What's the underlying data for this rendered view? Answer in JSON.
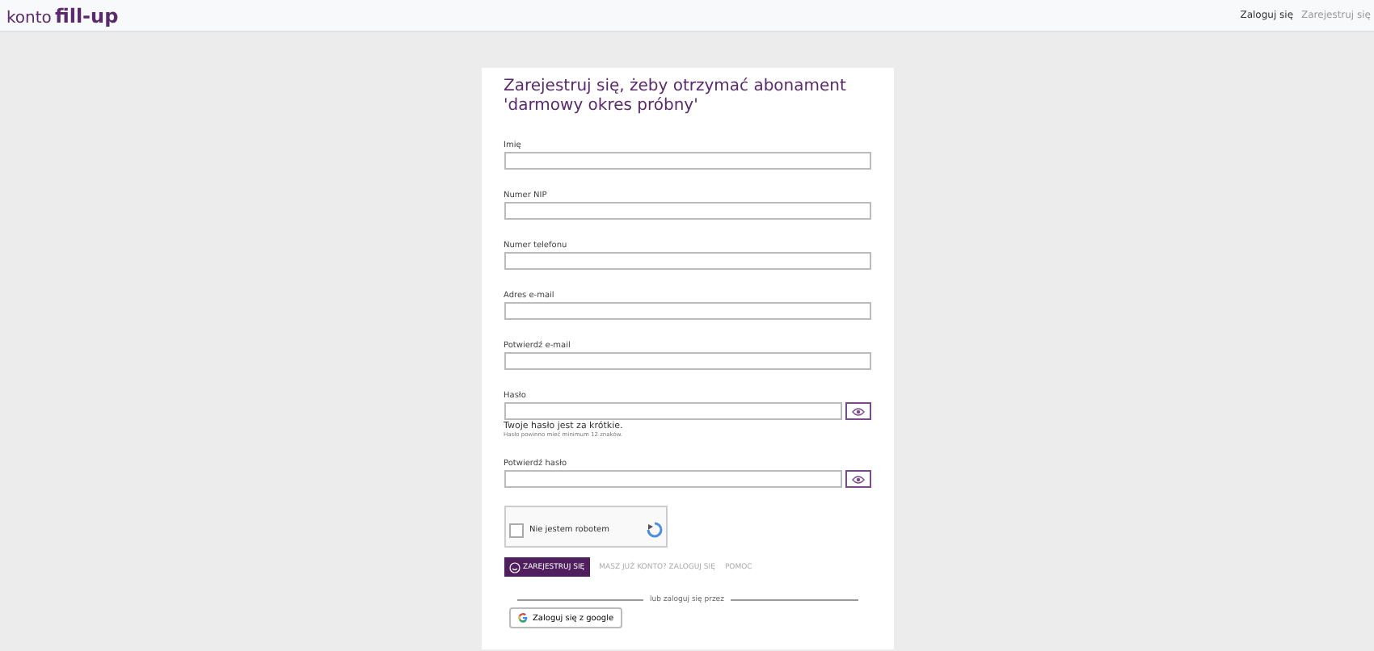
{
  "header": {
    "logo_prefix": "konto",
    "logo_brand": "fill-up",
    "nav": [
      {
        "label": "Zaloguj się",
        "selected": true
      },
      {
        "label": "Zarejestruj się",
        "selected": false
      }
    ]
  },
  "form": {
    "title": "Zarejestruj się, żeby otrzymać abonament 'darmowy okres próbny'",
    "fields": [
      {
        "label": "Imię",
        "kind": "text"
      },
      {
        "label": "Numer NIP",
        "kind": "text"
      },
      {
        "label": "Numer telefonu",
        "kind": "text"
      },
      {
        "label": "Adres e-mail",
        "kind": "text"
      },
      {
        "label": "Potwierdź e-mail",
        "kind": "text"
      },
      {
        "label": "Hasło",
        "kind": "password",
        "error": "Twoje hasło jest za krótkie.",
        "hint": "Hasło powinno mieć minimum 12 znaków."
      },
      {
        "label": "Potwierdź hasło",
        "kind": "password"
      }
    ],
    "captcha": {
      "label": "Nie jestem robotem",
      "checked": false
    },
    "submit": "ZAREJESTRUJ SIĘ",
    "links": [
      "MASZ JUŻ KONTO? ZALOGUJ SIĘ",
      "POMOC"
    ],
    "divider": "lub zaloguj się przez",
    "google": "Zaloguj się z google"
  }
}
